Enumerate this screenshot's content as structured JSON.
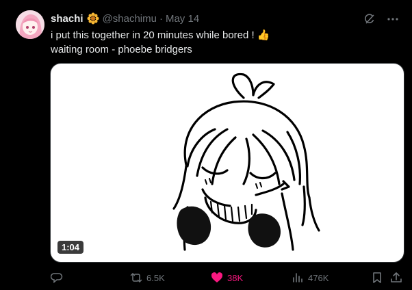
{
  "tweet": {
    "display_name": "shachi",
    "badge_icon": "sunflower-icon",
    "handle": "@shachimu",
    "separator": "·",
    "date": "May 14",
    "text_line1": "i put this together in 20 minutes while bored ! 👍",
    "text_line2": "waiting room - phoebe bridgers"
  },
  "media": {
    "duration": "1:04"
  },
  "actions": {
    "reply_count": "",
    "retweet_count": "6.5K",
    "like_count": "38K",
    "views_count": "476K"
  },
  "colors": {
    "background": "#000000",
    "text": "#e7e9ea",
    "muted": "#71767b",
    "like": "#f91880"
  }
}
